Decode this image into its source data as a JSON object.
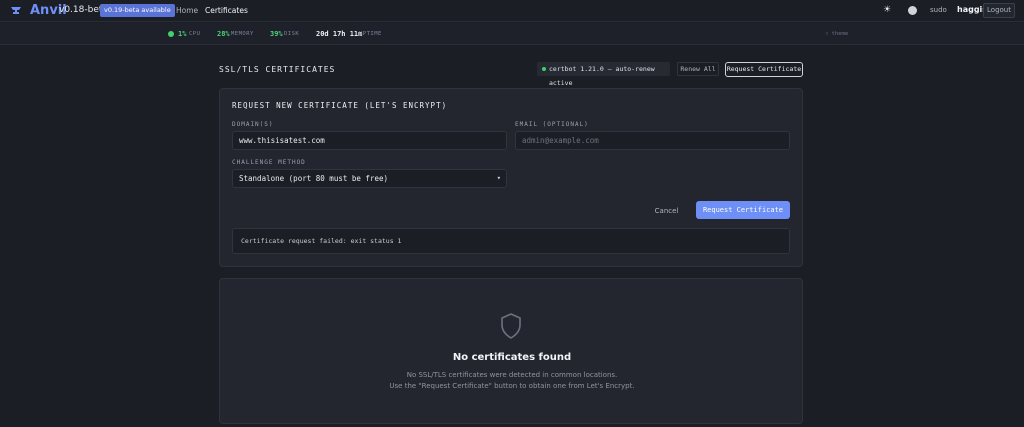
{
  "nav": {
    "brand": "Anvil",
    "version": "v0.18-beta",
    "update_badge": "v0.19-beta available",
    "links": [
      "Home",
      "Certificates"
    ],
    "theme_icon": "sun-icon",
    "sudo": "sudo",
    "username": "haggis",
    "logout": "Logout"
  },
  "stats": {
    "cpu_value": "1%",
    "cpu_label": "CPU",
    "memory_value": "28%",
    "memory_label": "MEMORY",
    "disk_value": "39%",
    "disk_label": "DISK",
    "uptime_value": "20d 17h 11m",
    "uptime_label": "UPTIME",
    "hint": "⇧ theme"
  },
  "header": {
    "title": "SSL/TLS CERTIFICATES",
    "certbot_status": "certbot 1.21.0 — auto-renew active",
    "renew_all": "Renew All",
    "request_certificate": "Request Certificate"
  },
  "form": {
    "title": "REQUEST NEW CERTIFICATE (LET'S ENCRYPT)",
    "domain_label": "DOMAIN(S)",
    "domain_value": "www.thisisatest.com",
    "email_label": "EMAIL (OPTIONAL)",
    "email_placeholder": "admin@example.com",
    "challenge_label": "CHALLENGE METHOD",
    "challenge_value": "Standalone (port 80 must be free)",
    "cancel": "Cancel",
    "submit": "Request Certificate",
    "error": "Certificate request failed: exit status 1"
  },
  "empty_state": {
    "icon": "shield-icon",
    "title": "No certificates found",
    "line1": "No SSL/TLS certificates were detected in common locations.",
    "line2": "Use the \"Request Certificate\" button to obtain one from Let's Encrypt."
  },
  "colors": {
    "accent": "#6d8ff6",
    "success": "#3fd26a",
    "background": "#1b1e25",
    "card": "#23262e"
  }
}
